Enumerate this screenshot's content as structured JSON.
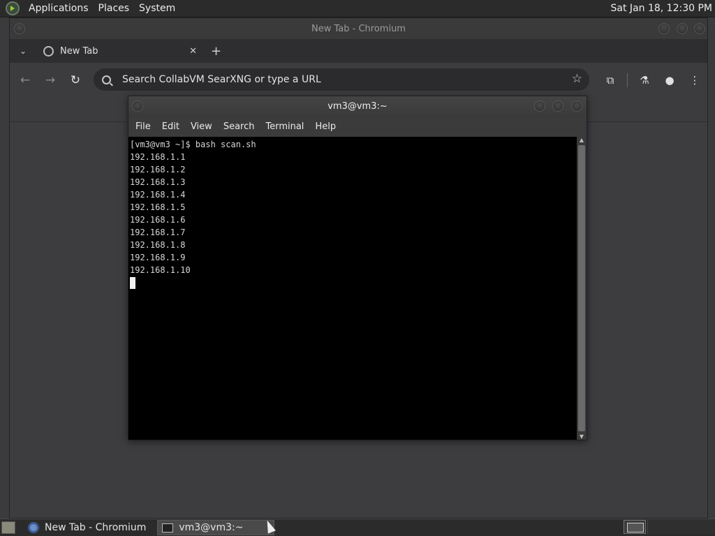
{
  "top_panel": {
    "menus": [
      "Applications",
      "Places",
      "System"
    ],
    "clock": "Sat Jan 18, 12:30 PM"
  },
  "chromium": {
    "window_title": "New Tab - Chromium",
    "tab_label": "New Tab",
    "omnibox_placeholder": "Search CollabVM SearXNG or type a URL"
  },
  "terminal": {
    "window_title": "vm3@vm3:~",
    "menus": [
      "File",
      "Edit",
      "View",
      "Search",
      "Terminal",
      "Help"
    ],
    "lines": [
      "[vm3@vm3 ~]$ bash scan.sh",
      "192.168.1.1",
      "192.168.1.2",
      "192.168.1.3",
      "192.168.1.4",
      "192.168.1.5",
      "192.168.1.6",
      "192.168.1.7",
      "192.168.1.8",
      "192.168.1.9",
      "192.168.1.10"
    ]
  },
  "taskbar": {
    "tasks": [
      "New Tab - Chromium",
      "vm3@vm3:~"
    ]
  },
  "icons": {
    "app_menu": "gnome-foot-icon",
    "tab_favicon": "globe-icon",
    "back": "arrow-left-icon",
    "forward": "arrow-right-icon",
    "reload": "reload-icon",
    "bookmark": "star-icon",
    "extensions": "puzzle-icon",
    "labs": "flask-icon",
    "profile": "avatar-icon",
    "menu": "kebab-menu-icon"
  }
}
